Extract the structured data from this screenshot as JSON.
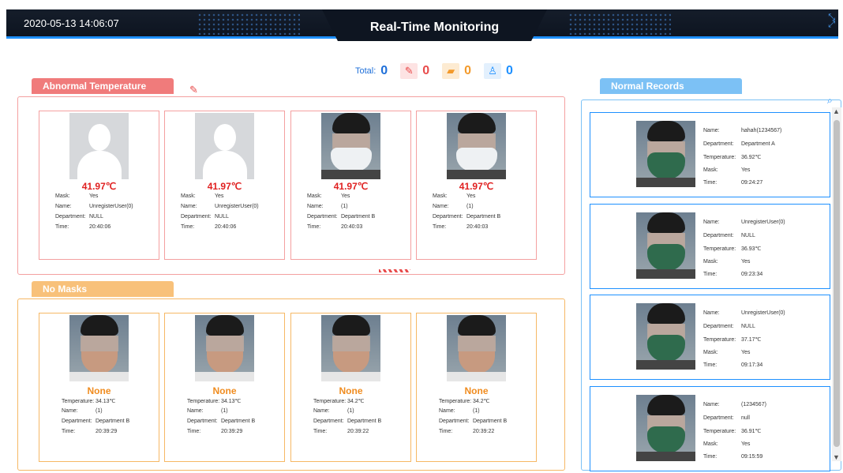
{
  "header": {
    "datetime": "2020-05-13 14:06:07",
    "title": "Real-Time Monitoring"
  },
  "totals": {
    "label": "Total:",
    "total": "0",
    "fever": "0",
    "no_mask": "0",
    "stranger": "0"
  },
  "colors": {
    "red": "#e84b4b",
    "orange": "#f39a2b",
    "blue": "#1e90ff",
    "temp_red": "#e02020",
    "none_orange": "#f08c1f"
  },
  "abnormal": {
    "title": "Abnormal Temperature",
    "cards": [
      {
        "temp": "41.97℃",
        "mask_label": "Mask:",
        "mask": "Yes",
        "name_label": "Name:",
        "name": "UnregisterUser(0)",
        "dept_label": "Department:",
        "dept": "NULL",
        "time_label": "Time:",
        "time": "20:40:06",
        "photo": "silhouette"
      },
      {
        "temp": "41.97℃",
        "mask_label": "Mask:",
        "mask": "Yes",
        "name_label": "Name:",
        "name": "UnregisterUser(0)",
        "dept_label": "Department:",
        "dept": "NULL",
        "time_label": "Time:",
        "time": "20:40:06",
        "photo": "silhouette"
      },
      {
        "temp": "41.97℃",
        "mask_label": "Mask:",
        "mask": "Yes",
        "name_label": "Name:",
        "name": "(1)",
        "dept_label": "Department:",
        "dept": "Department B",
        "time_label": "Time:",
        "time": "20:40:03",
        "photo": "white-mask"
      },
      {
        "temp": "41.97℃",
        "mask_label": "Mask:",
        "mask": "Yes",
        "name_label": "Name:",
        "name": "(1)",
        "dept_label": "Department:",
        "dept": "Department B",
        "time_label": "Time:",
        "time": "20:40:03",
        "photo": "white-mask"
      }
    ]
  },
  "nomask": {
    "title": "No Masks",
    "cards": [
      {
        "status": "None",
        "temp_label": "Temperature:",
        "temp": "34.13℃",
        "name_label": "Name:",
        "name": "(1)",
        "dept_label": "Department:",
        "dept": "Department B",
        "time_label": "Time:",
        "time": "20:39:29"
      },
      {
        "status": "None",
        "temp_label": "Temperature:",
        "temp": "34.13℃",
        "name_label": "Name:",
        "name": "(1)",
        "dept_label": "Department:",
        "dept": "Department B",
        "time_label": "Time:",
        "time": "20:39:29"
      },
      {
        "status": "None",
        "temp_label": "Temperature:",
        "temp": "34.2℃",
        "name_label": "Name:",
        "name": "(1)",
        "dept_label": "Department:",
        "dept": "Department B",
        "time_label": "Time:",
        "time": "20:39:22"
      },
      {
        "status": "None",
        "temp_label": "Temperature:",
        "temp": "34.2℃",
        "name_label": "Name:",
        "name": "(1)",
        "dept_label": "Department:",
        "dept": "Department B",
        "time_label": "Time:",
        "time": "20:39:22"
      }
    ]
  },
  "normal": {
    "title": "Normal Records",
    "cards": [
      {
        "name_label": "Name:",
        "name": "hahah(1234567)",
        "dept_label": "Department:",
        "dept": "Department A",
        "temp_label": "Temperature:",
        "temp": "36.92℃",
        "mask_label": "Mask:",
        "mask": "Yes",
        "time_label": "Time:",
        "time": "09:24:27"
      },
      {
        "name_label": "Name:",
        "name": "UnregisterUser(0)",
        "dept_label": "Department:",
        "dept": "NULL",
        "temp_label": "Temperature:",
        "temp": "36.93℃",
        "mask_label": "Mask:",
        "mask": "Yes",
        "time_label": "Time:",
        "time": "09:23:34"
      },
      {
        "name_label": "Name:",
        "name": "UnregisterUser(0)",
        "dept_label": "Department:",
        "dept": "NULL",
        "temp_label": "Temperature:",
        "temp": "37.17℃",
        "mask_label": "Mask:",
        "mask": "Yes",
        "time_label": "Time:",
        "time": "09:17:34"
      },
      {
        "name_label": "Name:",
        "name": "(1234567)",
        "dept_label": "Department:",
        "dept": "null",
        "temp_label": "Temperature:",
        "temp": "36.91℃",
        "mask_label": "Mask:",
        "mask": "Yes",
        "time_label": "Time:",
        "time": "09:15:59"
      }
    ]
  }
}
